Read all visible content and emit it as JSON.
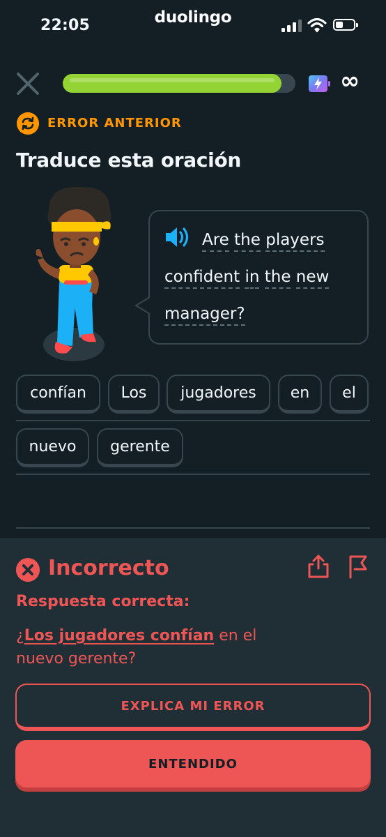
{
  "status_bar": {
    "time": "22:05",
    "brand": "duolingo",
    "icons": [
      "signal-icon",
      "wifi-icon",
      "battery-icon"
    ]
  },
  "top_bar": {
    "close_icon": "close-icon",
    "progress": 0.94,
    "progress_color": "#93d333",
    "energy_icon": "energy-icon",
    "energy_value": "∞"
  },
  "lesson": {
    "label": "ERROR ANTERIOR",
    "title": "Traduce esta oración",
    "prompt_lines": [
      [
        "Are",
        "the",
        "players"
      ],
      [
        "confident",
        "in",
        "the",
        "new"
      ],
      [
        "manager?"
      ]
    ]
  },
  "word_bank": [
    "confían",
    "Los",
    "jugadores",
    "en",
    "el",
    "nuevo",
    "gerente"
  ],
  "feedback": {
    "status": "Incorrecto",
    "label": "Respuesta correcta:",
    "answer_prefix": "¿",
    "answer_highlight": "Los jugadores confían",
    "answer_rest_line1": " en el",
    "answer_line2": "nuevo gerente?",
    "explain_button": "EXPLICA MI ERROR",
    "ok_button": "ENTENDIDO",
    "color": "#ee5555"
  },
  "colors": {
    "background": "#131f24",
    "panel": "#202f36",
    "accent_orange": "#ff9600",
    "accent_blue": "#1cb0f6"
  }
}
